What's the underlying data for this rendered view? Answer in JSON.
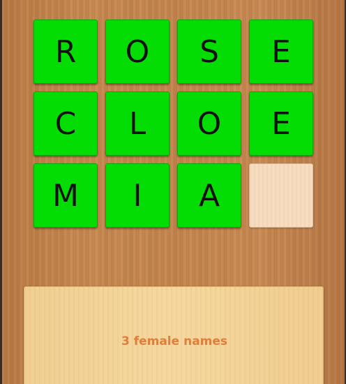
{
  "board": {
    "tiles": [
      {
        "letter": "R",
        "state": "filled"
      },
      {
        "letter": "O",
        "state": "filled"
      },
      {
        "letter": "S",
        "state": "filled"
      },
      {
        "letter": "E",
        "state": "filled"
      },
      {
        "letter": "C",
        "state": "filled"
      },
      {
        "letter": "L",
        "state": "filled"
      },
      {
        "letter": "O",
        "state": "filled"
      },
      {
        "letter": "E",
        "state": "filled"
      },
      {
        "letter": "M",
        "state": "filled"
      },
      {
        "letter": "I",
        "state": "filled"
      },
      {
        "letter": "A",
        "state": "filled"
      },
      {
        "letter": "",
        "state": "empty"
      }
    ]
  },
  "hint": {
    "text": "3 female names"
  },
  "colors": {
    "tile_filled": "#03dd03",
    "tile_empty": "#f6dcc0",
    "hint_text": "#e07e3c",
    "letter": "#111111"
  }
}
